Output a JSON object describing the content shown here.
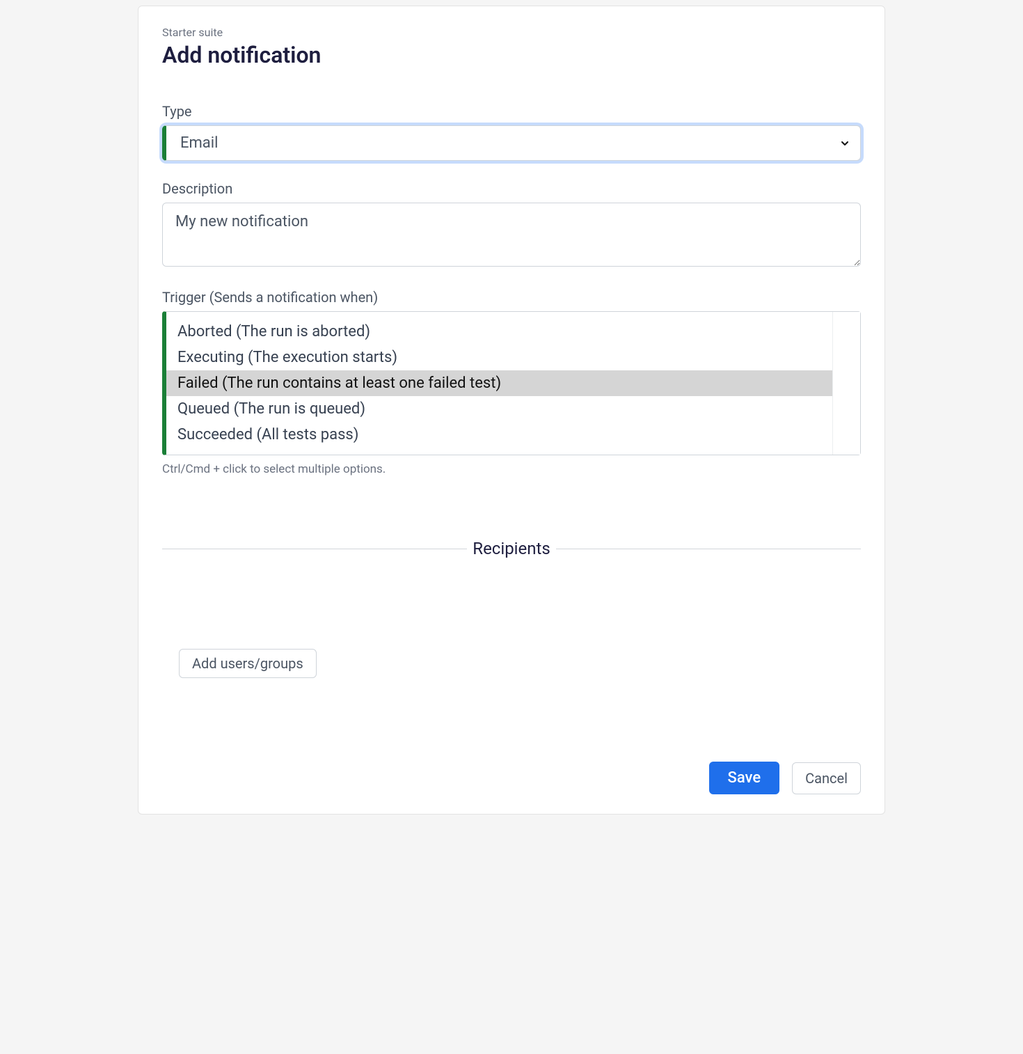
{
  "breadcrumb": "Starter suite",
  "page_title": "Add notification",
  "form": {
    "type": {
      "label": "Type",
      "selected": "Email"
    },
    "description": {
      "label": "Description",
      "value": "My new notification"
    },
    "trigger": {
      "label": "Trigger (Sends a notification when)",
      "options": [
        {
          "label": "Aborted (The run is aborted)",
          "selected": false
        },
        {
          "label": "Executing (The execution starts)",
          "selected": false
        },
        {
          "label": "Failed (The run contains at least one failed test)",
          "selected": true
        },
        {
          "label": "Queued (The run is queued)",
          "selected": false
        },
        {
          "label": "Succeeded (All tests pass)",
          "selected": false
        }
      ],
      "help": "Ctrl/Cmd + click to select multiple options."
    }
  },
  "recipients": {
    "section_title": "Recipients",
    "add_button": "Add users/groups"
  },
  "footer": {
    "save": "Save",
    "cancel": "Cancel"
  }
}
